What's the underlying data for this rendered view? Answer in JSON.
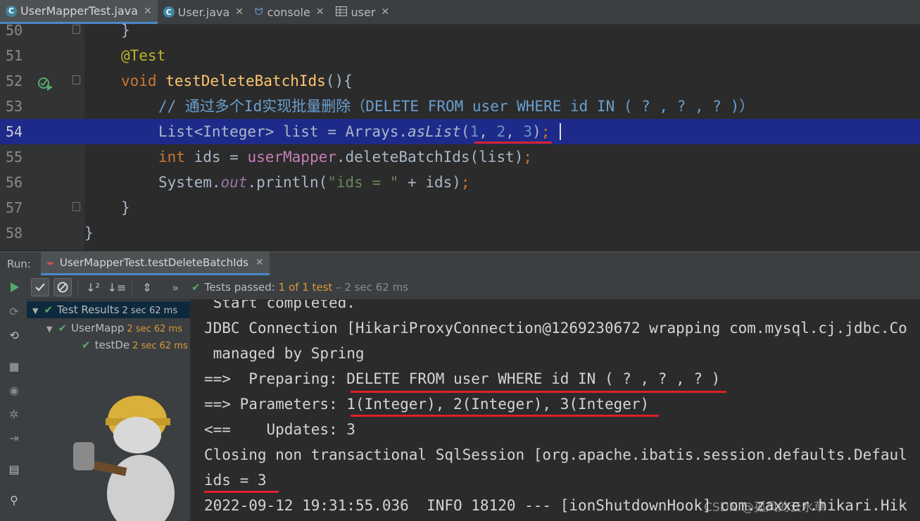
{
  "tabs": [
    {
      "label": "UserMapperTest.java",
      "icon": "java-test-class-icon",
      "active": true
    },
    {
      "label": "User.java",
      "icon": "java-class-icon",
      "active": false
    },
    {
      "label": "console",
      "icon": "sql-console-icon",
      "active": false
    },
    {
      "label": "user",
      "icon": "table-icon",
      "active": false
    }
  ],
  "editor": {
    "lines": [
      {
        "num": "50",
        "text": "}"
      },
      {
        "num": "51",
        "text": "@Test"
      },
      {
        "num": "52",
        "text": "void testDeleteBatchIds(){"
      },
      {
        "num": "53",
        "text": "// 通过多个Id实现批量删除（DELETE FROM user WHERE id IN ( ? , ? , ? )）"
      },
      {
        "num": "54",
        "text": "List<Integer> list = Arrays.asList(1, 2, 3);"
      },
      {
        "num": "55",
        "text": "int ids = userMapper.deleteBatchIds(list);"
      },
      {
        "num": "56",
        "text": "System.out.println(\"ids = \" + ids);"
      },
      {
        "num": "57",
        "text": "}"
      },
      {
        "num": "58",
        "text": "}"
      }
    ],
    "current_line": "54"
  },
  "run": {
    "label": "Run:",
    "tab_label": "UserMapperTest.testDeleteBatchIds",
    "status_prefix": "Tests passed:",
    "status_count": "1",
    "status_of": "of 1 test",
    "status_time": "– 2 sec 62 ms"
  },
  "tree": [
    {
      "label": "Test Results",
      "time": "2 sec 62 ms"
    },
    {
      "label": "UserMapp",
      "time": "2 sec 62 ms"
    },
    {
      "label": "testDe",
      "time": "2 sec 62 ms"
    }
  ],
  "console": [
    " Start completed.",
    "JDBC Connection [HikariProxyConnection@1269230672 wrapping com.mysql.cj.jdbc.Co",
    " managed by Spring",
    "==>  Preparing: DELETE FROM user WHERE id IN ( ? , ? , ? )",
    "==> Parameters: 1(Integer), 2(Integer), 3(Integer)",
    "<==    Updates: 3",
    "Closing non transactional SqlSession [org.apache.ibatis.session.defaults.Defaul",
    "ids = 3",
    "2022-09-12 19:31:55.036  INFO 18120 --- [ionShutdownHook] com.zaxxer.hikari.Hik"
  ],
  "watermark": "CSDN @孤风的云水草",
  "colors": {
    "accent": "#4a88c7",
    "pass": "#59a869",
    "underline": "#e0202a",
    "current_line": "#1e2a8a"
  }
}
